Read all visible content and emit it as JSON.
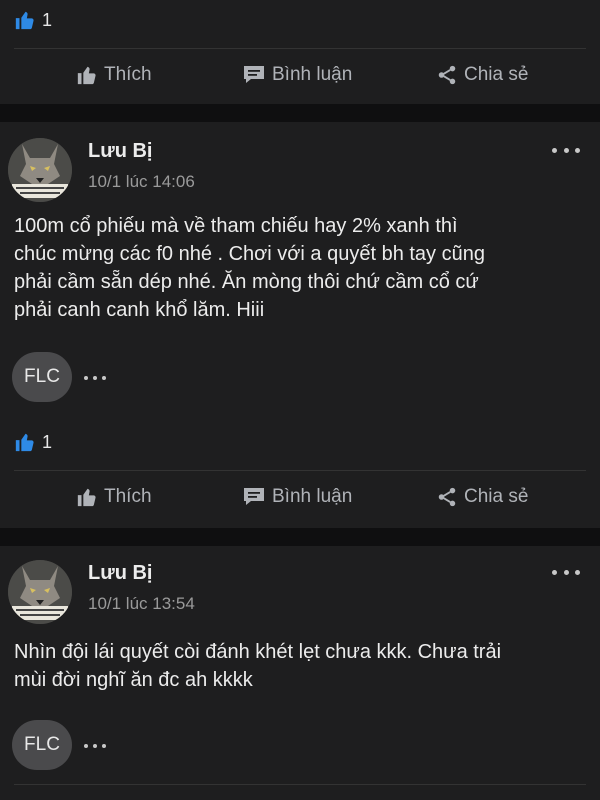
{
  "actions": {
    "like": "Thích",
    "comment": "Bình luận",
    "share": "Chia sẻ"
  },
  "colors": {
    "background": "#0f0f10",
    "card": "#1e1e1f",
    "like_blue": "#2e8ae6",
    "muted_text": "#b0b3b8"
  },
  "icons": [
    "thumbs-up-icon",
    "comment-icon",
    "share-icon",
    "more-dots-icon"
  ],
  "previous_post": {
    "like_count": "1"
  },
  "posts": [
    {
      "author": "Lưu Bị",
      "timestamp": "10/1 lúc 14:06",
      "text": "100m cổ phiếu mà về tham chiếu hay 2% xanh thì\nchúc mừng các f0 nhé . Chơi với a quyết bh tay cũng\nphải cầm sẵn dép nhé. Ăn mòng thôi chứ cầm cổ cứ\nphải canh canh khổ lăm. Hiii",
      "tag": "FLC",
      "like_count": "1"
    },
    {
      "author": "Lưu Bị",
      "timestamp": "10/1 lúc 13:54",
      "text": "Nhìn đội lái quyết còi đánh khét lẹt chưa kkk. Chưa trải\nmùi đời nghĩ ăn đc ah kkkk",
      "tag": "FLC"
    }
  ]
}
